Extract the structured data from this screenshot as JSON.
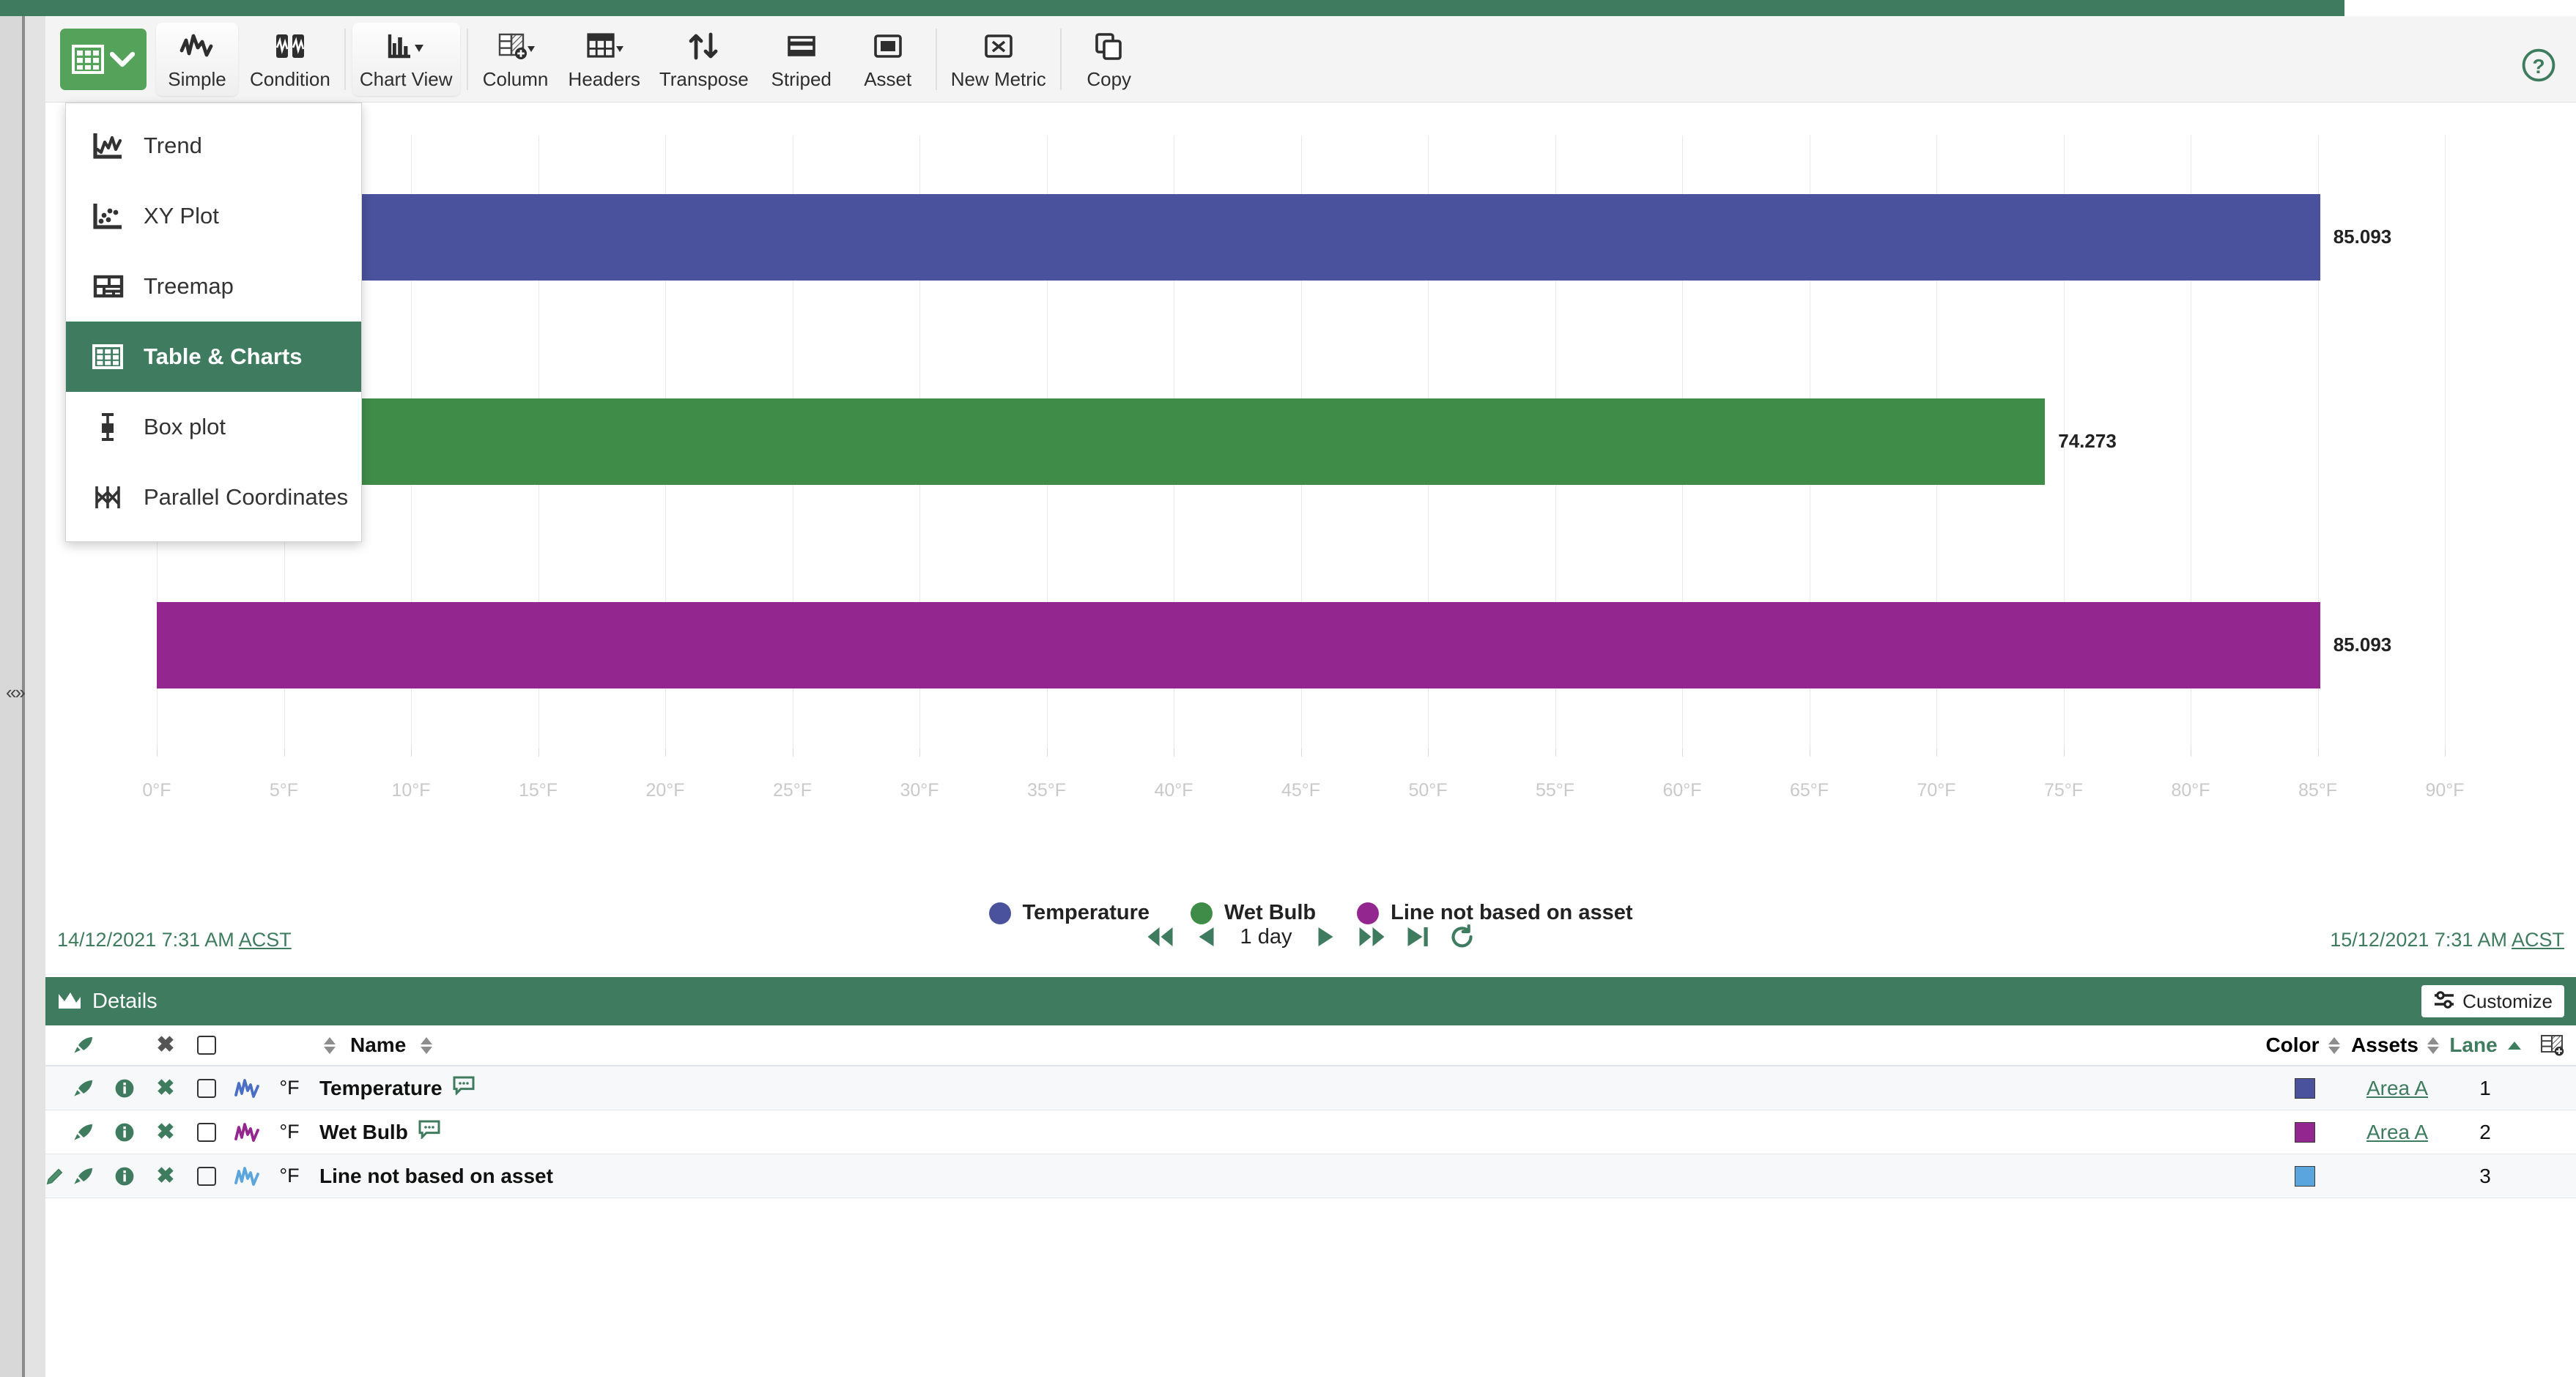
{
  "theme": {
    "green": "#3f7c5f",
    "button_green": "#55a35b"
  },
  "toolbar": {
    "grid_toggle": {
      "name": "table-view-toggle",
      "icon": "grid-icon"
    },
    "buttons": [
      {
        "label": "Simple",
        "icon": "trend-line-icon",
        "raised": true,
        "caret": false
      },
      {
        "label": "Condition",
        "icon": "condition-icon",
        "raised": false,
        "caret": false
      },
      {
        "label": "Chart View",
        "icon": "bar-chart-icon",
        "raised": true,
        "caret": true
      },
      {
        "label": "Column",
        "icon": "add-column-icon",
        "raised": false,
        "caret": true
      },
      {
        "label": "Headers",
        "icon": "headers-icon",
        "raised": false,
        "caret": true
      },
      {
        "label": "Transpose",
        "icon": "transpose-icon",
        "raised": false,
        "caret": false
      },
      {
        "label": "Striped",
        "icon": "striped-icon",
        "raised": false,
        "caret": false
      },
      {
        "label": "Asset",
        "icon": "asset-icon",
        "raised": false,
        "caret": false
      },
      {
        "label": "New Metric",
        "icon": "new-metric-icon",
        "raised": false,
        "caret": false
      },
      {
        "label": "Copy",
        "icon": "copy-icon",
        "raised": false,
        "caret": false
      }
    ],
    "help": {
      "name": "help-icon"
    }
  },
  "chart_menu": {
    "items": [
      {
        "label": "Trend",
        "icon": "trend-chart-icon",
        "active": false
      },
      {
        "label": "XY Plot",
        "icon": "scatter-plot-icon",
        "active": false
      },
      {
        "label": "Treemap",
        "icon": "treemap-icon",
        "active": false
      },
      {
        "label": "Table & Charts",
        "icon": "table-grid-icon",
        "active": true
      },
      {
        "label": "Box plot",
        "icon": "box-plot-icon",
        "active": false
      },
      {
        "label": "Parallel Coordinates",
        "icon": "parallel-coordinates-icon",
        "active": false
      }
    ]
  },
  "chart_data": {
    "type": "bar",
    "orientation": "horizontal",
    "title": "",
    "xlabel": "",
    "ylabel": "",
    "xlim": [
      0,
      90
    ],
    "xtick_step": 5,
    "xtick_suffix": "°F",
    "grid": true,
    "legend_position": "bottom",
    "tick_labels": [
      "0°F",
      "5°F",
      "10°F",
      "15°F",
      "20°F",
      "25°F",
      "30°F",
      "35°F",
      "40°F",
      "45°F",
      "50°F",
      "55°F",
      "60°F",
      "65°F",
      "70°F",
      "75°F",
      "80°F",
      "85°F",
      "90°F"
    ],
    "categories": [
      "Temperature",
      "Wet Bulb",
      "Line not based on asset"
    ],
    "values": [
      85.093,
      74.273,
      85.093
    ],
    "value_labels": [
      "85.093",
      "74.273",
      "85.093"
    ],
    "bar_start": [
      5.0,
      5.0,
      0.0
    ],
    "colors": [
      "#4a529e",
      "#3f8c49",
      "#94268f"
    ],
    "legend": [
      {
        "label": "Temperature",
        "color": "#4a529e"
      },
      {
        "label": "Wet Bulb",
        "color": "#3f8c49"
      },
      {
        "label": "Line not based on asset",
        "color": "#94268f"
      }
    ]
  },
  "timebar": {
    "start": "14/12/2021 7:31 AM",
    "start_tz": "ACST",
    "end": "15/12/2021 7:31 AM",
    "end_tz": "ACST",
    "range_label": "1 day",
    "controls": [
      "skip-back-icon",
      "step-back-icon",
      "step-forward-icon",
      "skip-forward-icon",
      "jump-end-icon",
      "refresh-icon"
    ]
  },
  "details": {
    "title": "Details",
    "title_icon": "chart-area-icon",
    "customize_label": "Customize",
    "customize_icon": "sliders-icon",
    "add_column_icon": "add-column-icon",
    "columns": {
      "name": "Name",
      "color": "Color",
      "assets": "Assets",
      "lane": "Lane"
    },
    "rows": [
      {
        "edit": false,
        "unit": "°F",
        "name": "Temperature",
        "has_comment": true,
        "signal_color": "#4a6fc4",
        "color": "#4a529e",
        "asset": "Area A",
        "lane": "1",
        "alt": true
      },
      {
        "edit": false,
        "unit": "°F",
        "name": "Wet Bulb",
        "has_comment": true,
        "signal_color": "#94268f",
        "color": "#94268f",
        "asset": "Area A",
        "lane": "2",
        "alt": false
      },
      {
        "edit": true,
        "unit": "°F",
        "name": "Line not based on asset",
        "has_comment": false,
        "signal_color": "#5aa5dd",
        "color": "#5aa5dd",
        "asset": "",
        "lane": "3",
        "alt": true
      }
    ]
  }
}
